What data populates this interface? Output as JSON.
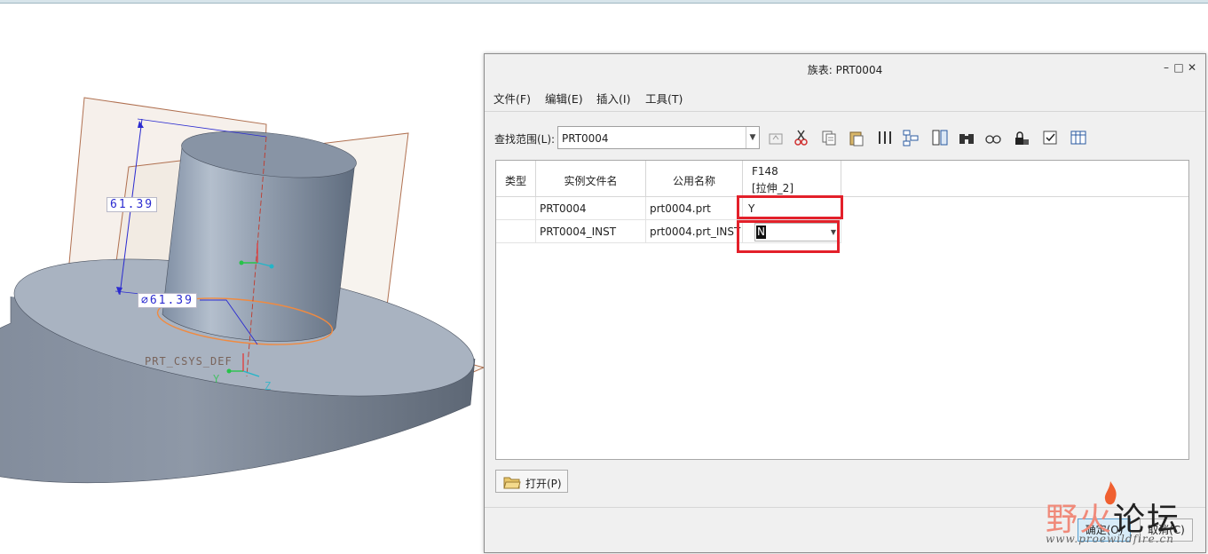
{
  "viewport": {
    "dim_height": "61.39",
    "dim_diameter": "∅61.39",
    "csys_label": "PRT_CSYS_DEF",
    "axis_y": "Y",
    "axis_z": "Z"
  },
  "dialog": {
    "title": "族表: PRT0004",
    "menu": [
      "文件(F)",
      "编辑(E)",
      "插入(I)",
      "工具(T)"
    ],
    "scope_label": "查找范围(L):",
    "scope_value": "PRT0004",
    "toolbar_icons": [
      "up-level-icon",
      "cut-icon",
      "copy-icon",
      "paste-icon",
      "insert-column-icon",
      "tree-icon",
      "column-icon",
      "binoculars-icon",
      "glasses-icon",
      "lock-icon",
      "checkbox-icon",
      "table-icon"
    ],
    "columns": {
      "type": "类型",
      "instance": "实例文件名",
      "common": "公用名称",
      "feature_line1": "F148",
      "feature_line2": "[拉伸_2]"
    },
    "rows": [
      {
        "type": "",
        "instance": "PRT0004",
        "common": "prt0004.prt",
        "value": "Y"
      },
      {
        "type": "",
        "instance": "PRT0004_INST",
        "common": "prt0004.prt_INST",
        "value": "N"
      }
    ],
    "open_button": "打开(P)",
    "ok_button": "确定(O)",
    "cancel_button": "取消(C)"
  },
  "watermark": {
    "text_a": "野火",
    "text_b": "论坛",
    "url": "www.proewildfire.cn"
  },
  "colors": {
    "highlight": "#e3202a",
    "dimension": "#2b2bd0"
  }
}
